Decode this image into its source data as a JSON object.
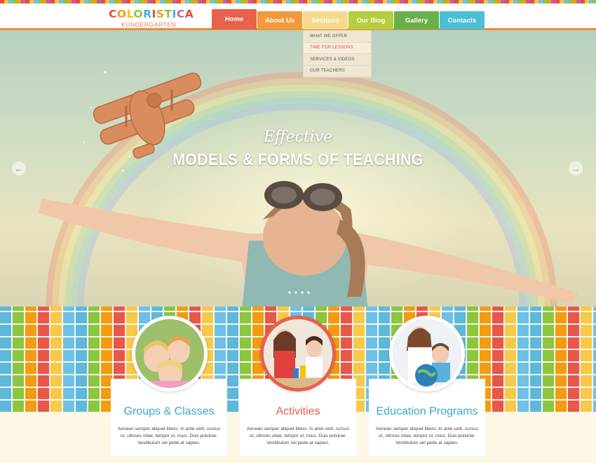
{
  "logo": {
    "title_letters": [
      "C",
      "O",
      "L",
      "O",
      "R",
      "I",
      "S",
      "T",
      "I",
      "C",
      "A"
    ],
    "letter_colors": [
      "#e74c3c",
      "#f39c12",
      "#f1c40f",
      "#8cc63e",
      "#3db4e0",
      "#e74c3c",
      "#f39c12",
      "#8cc63e",
      "#3db4e0",
      "#b565a7",
      "#e74c3c"
    ],
    "subtitle": "KUNDERGARTEN"
  },
  "nav": {
    "items": [
      {
        "label": "Home",
        "color": "#e8614a"
      },
      {
        "label": "About Us",
        "color": "#f29a3b"
      },
      {
        "label": "Sections",
        "color": "#f7d98e"
      },
      {
        "label": "Our Blog",
        "color": "#b6cd3e"
      },
      {
        "label": "Gallery",
        "color": "#6aaf4c"
      },
      {
        "label": "Contacts",
        "color": "#4bbfd6"
      }
    ],
    "active": "Home"
  },
  "dropdown": {
    "items": [
      "WHAT WE OFFER",
      "TIME FOR LESSONS",
      "SERVICES & VIDEOS",
      "OUR TEACHERS"
    ],
    "highlighted": "TIME FOR LESSONS"
  },
  "hero": {
    "script_text": "Effective",
    "title": "MODELS & FORMS OF  TEACHING",
    "prev_icon": "arrow-left-icon",
    "next_icon": "arrow-right-icon",
    "slide_count": 4
  },
  "cards": [
    {
      "title": "Groups & Classes",
      "title_color": "#3aa7c9",
      "text": "Aenean semper aliquet libero. In ante velit, cursus ut, ultrices vitae, tempor ut, risus. Duis pulvinar. Vestibulum vel pede at sapien.",
      "ring_color": "#ffffff"
    },
    {
      "title": "Activities",
      "title_color": "#e8614a",
      "text": "Aenean semper aliquet libero. In ante velit, cursus ut, ultrices vitae, tempor ut, risus. Duis pulvinar. Vestibulum vel pede at sapien.",
      "ring_color": "#e8614a"
    },
    {
      "title": "Education Programs",
      "title_color": "#3aa7c9",
      "text": "Aenean semper aliquet libero. In ante velit, cursus ut, ultrices vitae, tempor ut, risus. Duis pulvinar. Vestibulum vel pede at sapien.",
      "ring_color": "#ffffff"
    }
  ]
}
